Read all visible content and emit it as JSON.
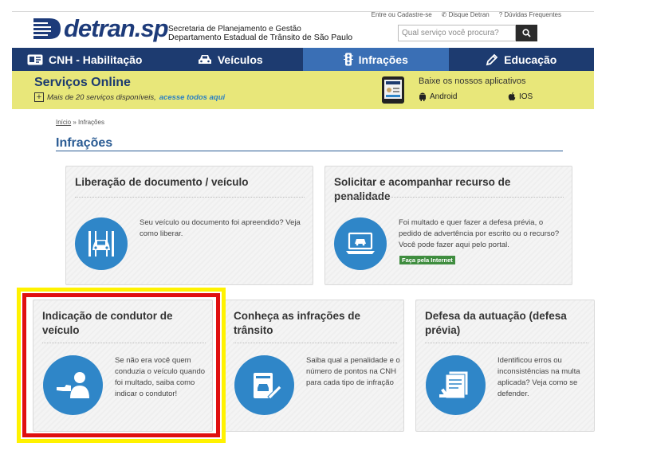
{
  "toplinks": [
    "Entre ou Cadastre-se",
    "Disque Detran",
    "Dúvidas Frequentes"
  ],
  "logo": {
    "text": "detran.sp"
  },
  "department": {
    "line1": "Secretaria de Planejamento e Gestão",
    "line2": "Departamento Estadual de Trânsito de São Paulo"
  },
  "search": {
    "placeholder": "Qual serviço você procura?"
  },
  "nav": [
    {
      "label": "CNH - Habilitação",
      "icon": "license-card-icon"
    },
    {
      "label": "Veículos",
      "icon": "car-icon"
    },
    {
      "label": "Infrações",
      "icon": "traffic-light-icon",
      "active": true
    },
    {
      "label": "Educação",
      "icon": "pencil-icon"
    }
  ],
  "banner": {
    "title": "Serviços Online",
    "sub_text": "Mais de 20 serviços disponíveis,",
    "sub_link": "acesse todos aqui",
    "apps_title": "Baixe os nossos aplicativos",
    "android": "Android",
    "ios": "IOS"
  },
  "breadcrumb": {
    "home": "Início",
    "separator": "»",
    "current": "Infrações"
  },
  "page_title": "Infrações",
  "cards": [
    {
      "title": "Liberação de documento / veículo",
      "text": "Seu veículo ou documento foi apreendido? Veja como liberar.",
      "icon": "car-release-icon"
    },
    {
      "title": "Solicitar e acompanhar recurso de penalidade",
      "text": "Foi multado e quer fazer a defesa prévia, o pedido de advertência por escrito ou o recurso? Você pode fazer aqui pelo portal.",
      "badge": "Faça pela Internet",
      "icon": "laptop-icon"
    },
    {
      "title": "Indicação de condutor de veículo",
      "text": "Se não era você quem conduzia o veículo quando foi multado, saiba como indicar o condutor!",
      "icon": "driver-indication-icon"
    },
    {
      "title": "Conheça as infrações de trânsito",
      "text": "Saiba qual a penalidade e o número de pontos na CNH para cada tipo de infração",
      "icon": "document-pen-icon"
    },
    {
      "title": "Defesa da autuação (defesa prévia)",
      "text": "Identificou erros ou inconsistências na multa aplicada? Veja como se defender.",
      "icon": "gavel-icon"
    }
  ],
  "colors": {
    "nav_bg": "#1d3b70",
    "nav_active": "#3a6fb5",
    "banner_bg": "#e8e77a",
    "icon_blue": "#2f86c8",
    "highlight_yellow": "#fff200",
    "highlight_red": "#e01010"
  }
}
